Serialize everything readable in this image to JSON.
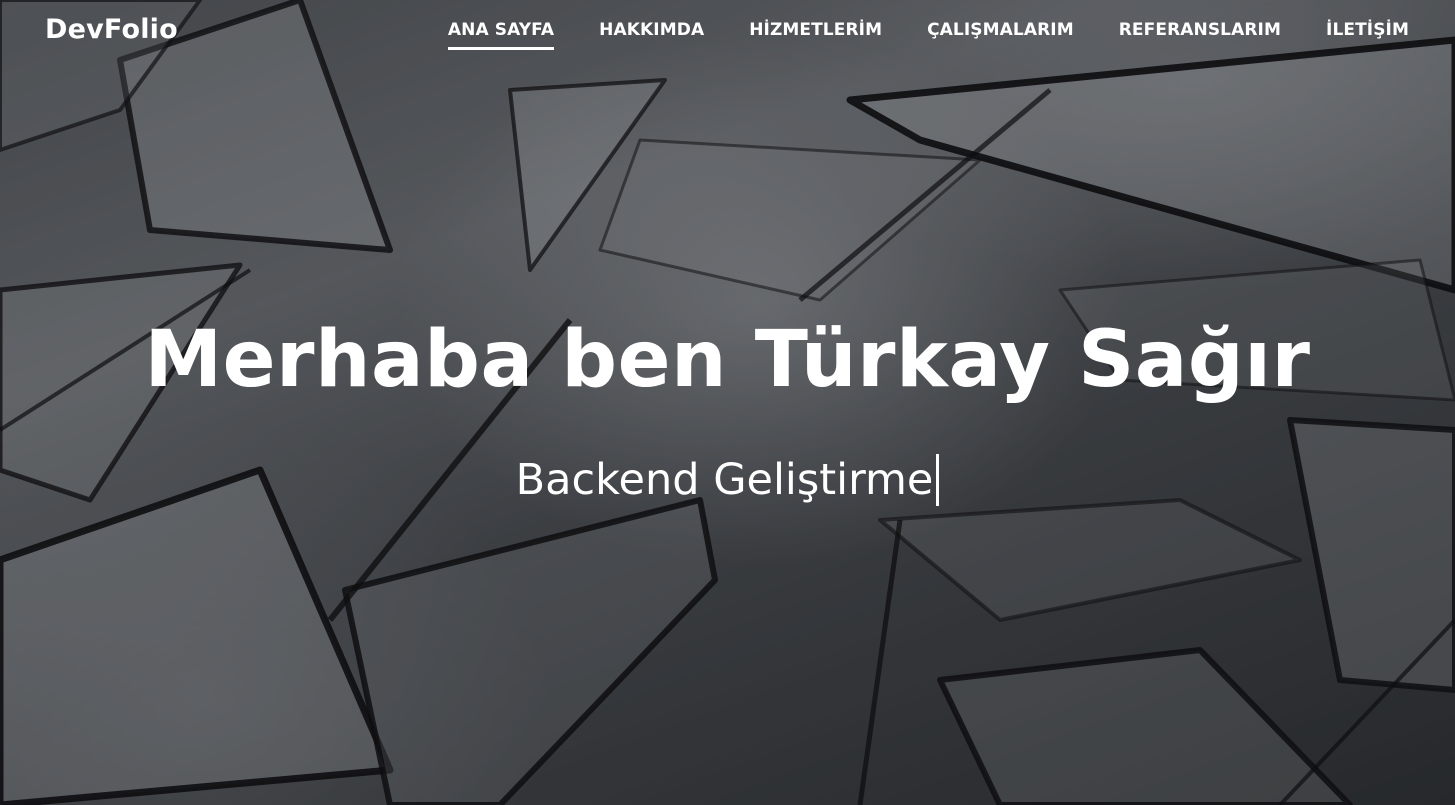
{
  "navbar": {
    "brand": "DevFolio",
    "items": [
      {
        "label": "ANA SAYFA",
        "active": true
      },
      {
        "label": "HAKKIMDA",
        "active": false
      },
      {
        "label": "HİZMETLERİM",
        "active": false
      },
      {
        "label": "ÇALIŞMALARIM",
        "active": false
      },
      {
        "label": "REFERANSLARIM",
        "active": false
      },
      {
        "label": "İLETİŞİM",
        "active": false
      }
    ]
  },
  "hero": {
    "title": "Merhaba ben Türkay Sağır",
    "subtitle": "Backend Geliştirme"
  },
  "colors": {
    "text": "#ffffff",
    "background": "#4a4e52"
  }
}
